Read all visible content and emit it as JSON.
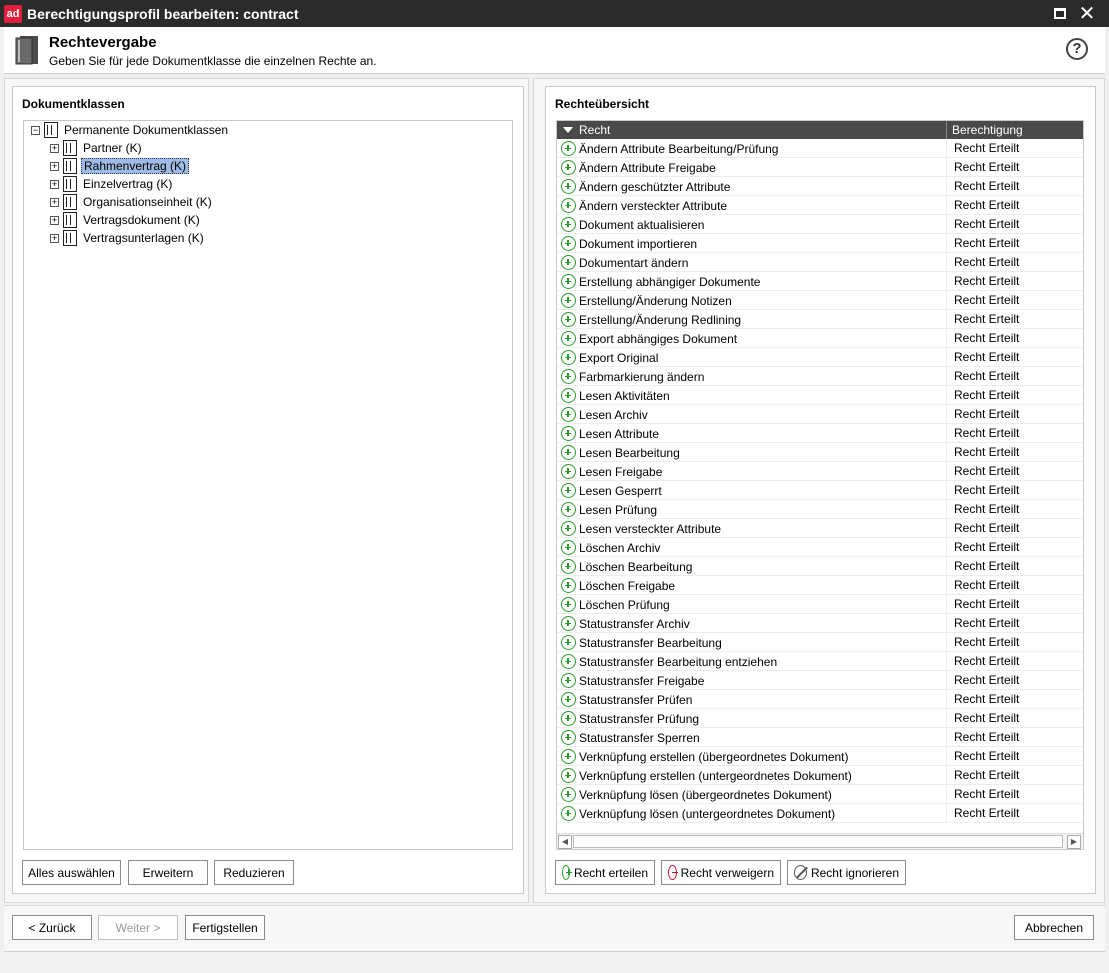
{
  "window": {
    "logo_text": "ad",
    "title": "Berechtigungsprofil bearbeiten: contract"
  },
  "header": {
    "title": "Rechtevergabe",
    "subtitle": "Geben Sie für jede Dokumentklasse die einzelnen Rechte an.",
    "help_symbol": "?"
  },
  "left_panel": {
    "title": "Dokumentklassen",
    "tree": {
      "root": "Permanente Dokumentklassen",
      "children": [
        "Partner (K)",
        "Rahmenvertrag (K)",
        "Einzelvertrag (K)",
        "Organisationseinheit (K)",
        "Vertragsdokument (K)",
        "Vertragsunterlagen (K)"
      ],
      "selected_index": 1
    },
    "buttons": {
      "select_all": "Alles auswählen",
      "expand": "Erweitern",
      "reduce": "Reduzieren"
    }
  },
  "right_panel": {
    "title": "Rechteübersicht",
    "columns": {
      "recht": "Recht",
      "berechtigung": "Berechtigung"
    },
    "rows": [
      {
        "recht": "Ändern Attribute Bearbeitung/Prüfung",
        "berechtigung": "Recht Erteilt"
      },
      {
        "recht": "Ändern Attribute Freigabe",
        "berechtigung": "Recht Erteilt"
      },
      {
        "recht": "Ändern geschützter Attribute",
        "berechtigung": "Recht Erteilt"
      },
      {
        "recht": "Ändern versteckter Attribute",
        "berechtigung": "Recht Erteilt"
      },
      {
        "recht": "Dokument aktualisieren",
        "berechtigung": "Recht Erteilt"
      },
      {
        "recht": "Dokument importieren",
        "berechtigung": "Recht Erteilt"
      },
      {
        "recht": "Dokumentart ändern",
        "berechtigung": "Recht Erteilt"
      },
      {
        "recht": "Erstellung abhängiger Dokumente",
        "berechtigung": "Recht Erteilt"
      },
      {
        "recht": "Erstellung/Änderung Notizen",
        "berechtigung": "Recht Erteilt"
      },
      {
        "recht": "Erstellung/Änderung Redlining",
        "berechtigung": "Recht Erteilt"
      },
      {
        "recht": "Export abhängiges Dokument",
        "berechtigung": "Recht Erteilt"
      },
      {
        "recht": "Export Original",
        "berechtigung": "Recht Erteilt"
      },
      {
        "recht": "Farbmarkierung ändern",
        "berechtigung": "Recht Erteilt"
      },
      {
        "recht": "Lesen Aktivitäten",
        "berechtigung": "Recht Erteilt"
      },
      {
        "recht": "Lesen Archiv",
        "berechtigung": "Recht Erteilt"
      },
      {
        "recht": "Lesen Attribute",
        "berechtigung": "Recht Erteilt"
      },
      {
        "recht": "Lesen Bearbeitung",
        "berechtigung": "Recht Erteilt"
      },
      {
        "recht": "Lesen Freigabe",
        "berechtigung": "Recht Erteilt"
      },
      {
        "recht": "Lesen Gesperrt",
        "berechtigung": "Recht Erteilt"
      },
      {
        "recht": "Lesen Prüfung",
        "berechtigung": "Recht Erteilt"
      },
      {
        "recht": "Lesen versteckter Attribute",
        "berechtigung": "Recht Erteilt"
      },
      {
        "recht": "Löschen Archiv",
        "berechtigung": "Recht Erteilt"
      },
      {
        "recht": "Löschen Bearbeitung",
        "berechtigung": "Recht Erteilt"
      },
      {
        "recht": "Löschen Freigabe",
        "berechtigung": "Recht Erteilt"
      },
      {
        "recht": "Löschen Prüfung",
        "berechtigung": "Recht Erteilt"
      },
      {
        "recht": "Statustransfer Archiv",
        "berechtigung": "Recht Erteilt"
      },
      {
        "recht": "Statustransfer Bearbeitung",
        "berechtigung": "Recht Erteilt"
      },
      {
        "recht": "Statustransfer Bearbeitung entziehen",
        "berechtigung": "Recht Erteilt"
      },
      {
        "recht": "Statustransfer Freigabe",
        "berechtigung": "Recht Erteilt"
      },
      {
        "recht": "Statustransfer Prüfen",
        "berechtigung": "Recht Erteilt"
      },
      {
        "recht": "Statustransfer Prüfung",
        "berechtigung": "Recht Erteilt"
      },
      {
        "recht": "Statustransfer Sperren",
        "berechtigung": "Recht Erteilt"
      },
      {
        "recht": "Verknüpfung erstellen (übergeordnetes Dokument)",
        "berechtigung": "Recht Erteilt"
      },
      {
        "recht": "Verknüpfung erstellen (untergeordnetes Dokument)",
        "berechtigung": "Recht Erteilt"
      },
      {
        "recht": "Verknüpfung lösen (übergeordnetes Dokument)",
        "berechtigung": "Recht Erteilt"
      },
      {
        "recht": "Verknüpfung lösen (untergeordnetes Dokument)",
        "berechtigung": "Recht Erteilt"
      }
    ],
    "buttons": {
      "grant": "Recht erteilen",
      "deny": "Recht verweigern",
      "ignore": "Recht ignorieren"
    }
  },
  "footer": {
    "back": "< Zurück",
    "next": "Weiter >",
    "finish": "Fertigstellen",
    "cancel": "Abbrechen"
  },
  "colors": {
    "grant_green": "#2d9a2d",
    "deny_red": "#c8102e",
    "selection_blue": "#9dbbe4",
    "header_dark": "#4a4a4a"
  }
}
